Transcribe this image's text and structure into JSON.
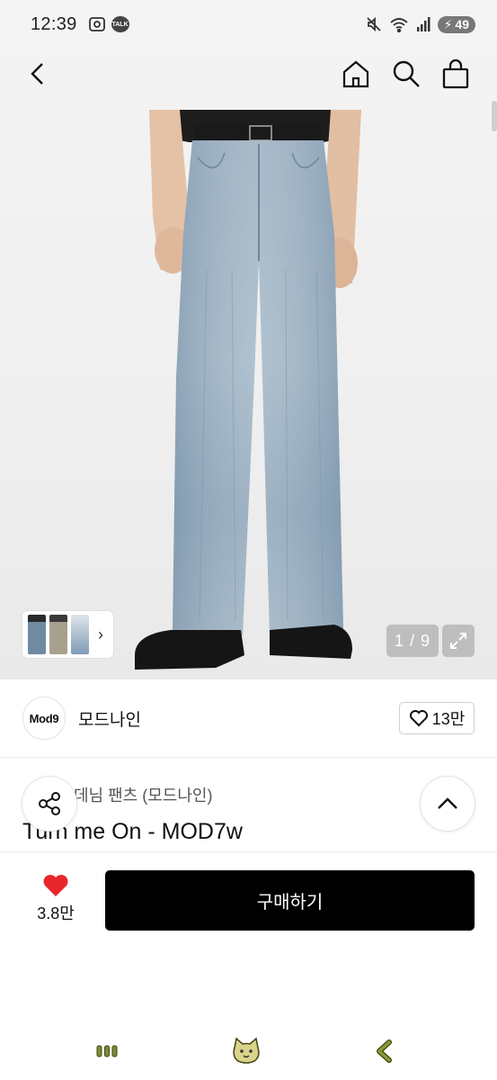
{
  "status_bar": {
    "time": "12:39",
    "talk_badge": "TALK",
    "battery": "49"
  },
  "gallery": {
    "counter": "1 / 9"
  },
  "brand": {
    "logo_text": "Mod9",
    "name": "모드나인",
    "like_count": "13만"
  },
  "product": {
    "category": "데님 팬츠 (모드나인)",
    "title": "Turn me On - MOD7w"
  },
  "purchase": {
    "wish_count": "3.8만",
    "buy_label": "구매하기"
  },
  "colors": {
    "accent": "#000000",
    "heart": "#e8262b"
  }
}
